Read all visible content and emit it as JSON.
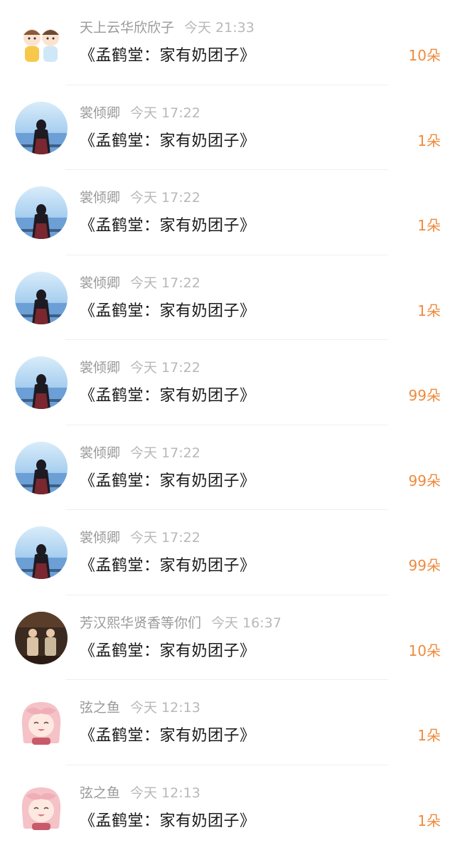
{
  "colors": {
    "accent": "#ef8a3c",
    "name": "#9a9a9a",
    "time": "#b8b8b8",
    "title": "#1a1a1a"
  },
  "items": [
    {
      "avatar": "avatar-cartoon-boys",
      "name": "天上云华欣欣子",
      "time": "今天 21:33",
      "title": "《孟鹤堂：家有奶团子》",
      "count": "10朵"
    },
    {
      "avatar": "avatar-sea-silhouette",
      "name": "裳倾卿",
      "time": "今天 17:22",
      "title": "《孟鹤堂：家有奶团子》",
      "count": "1朵"
    },
    {
      "avatar": "avatar-sea-silhouette",
      "name": "裳倾卿",
      "time": "今天 17:22",
      "title": "《孟鹤堂：家有奶团子》",
      "count": "1朵"
    },
    {
      "avatar": "avatar-sea-silhouette",
      "name": "裳倾卿",
      "time": "今天 17:22",
      "title": "《孟鹤堂：家有奶团子》",
      "count": "1朵"
    },
    {
      "avatar": "avatar-sea-silhouette",
      "name": "裳倾卿",
      "time": "今天 17:22",
      "title": "《孟鹤堂：家有奶团子》",
      "count": "99朵"
    },
    {
      "avatar": "avatar-sea-silhouette",
      "name": "裳倾卿",
      "time": "今天 17:22",
      "title": "《孟鹤堂：家有奶团子》",
      "count": "99朵"
    },
    {
      "avatar": "avatar-sea-silhouette",
      "name": "裳倾卿",
      "time": "今天 17:22",
      "title": "《孟鹤堂：家有奶团子》",
      "count": "99朵"
    },
    {
      "avatar": "avatar-stage-performers",
      "name": "芳汉熙华贤香等你们",
      "time": "今天 16:37",
      "title": "《孟鹤堂：家有奶团子》",
      "count": "10朵"
    },
    {
      "avatar": "avatar-anime-girl",
      "name": "弦之鱼",
      "time": "今天 12:13",
      "title": "《孟鹤堂：家有奶团子》",
      "count": "1朵"
    },
    {
      "avatar": "avatar-anime-girl",
      "name": "弦之鱼",
      "time": "今天 12:13",
      "title": "《孟鹤堂：家有奶团子》",
      "count": "1朵"
    }
  ]
}
